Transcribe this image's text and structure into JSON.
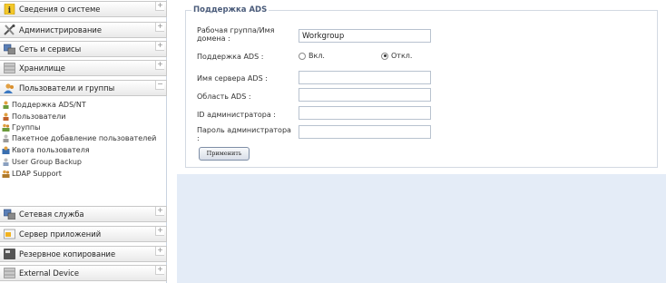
{
  "sidebar": {
    "menus": [
      {
        "label": "Сведения о системе",
        "icon": "info-icon",
        "toggle": "+"
      },
      {
        "label": "Администрирование",
        "icon": "tools-icon",
        "toggle": "+"
      },
      {
        "label": "Сеть и сервисы",
        "icon": "network-icon",
        "toggle": "+"
      },
      {
        "label": "Хранилище",
        "icon": "storage-icon",
        "toggle": "+"
      },
      {
        "label": "Пользователи и группы",
        "icon": "users-icon",
        "toggle": "−"
      },
      {
        "label": "Сетевая служба",
        "icon": "network-service-icon",
        "toggle": "+"
      },
      {
        "label": "Сервер приложений",
        "icon": "app-server-icon",
        "toggle": "+"
      },
      {
        "label": "Резервное копирование",
        "icon": "backup-icon",
        "toggle": "+"
      },
      {
        "label": "External Device",
        "icon": "external-device-icon",
        "toggle": "+"
      }
    ],
    "submenu": [
      {
        "label": "Поддержка ADS/NT",
        "icon": "ads-icon"
      },
      {
        "label": "Пользователи",
        "icon": "user-icon"
      },
      {
        "label": "Группы",
        "icon": "group-icon"
      },
      {
        "label": "Пакетное добавление пользователей",
        "icon": "batch-add-icon"
      },
      {
        "label": "Квота пользователя",
        "icon": "quota-icon"
      },
      {
        "label": "User Group Backup",
        "icon": "user-group-backup-icon"
      },
      {
        "label": "LDAP Support",
        "icon": "ldap-icon"
      }
    ]
  },
  "form": {
    "legend": "Поддержка ADS",
    "workgroup_label": "Рабочая группа/Имя домена :",
    "workgroup_value": "Workgroup",
    "ads_label": "Поддержка ADS :",
    "ads_on": "Вкл.",
    "ads_off": "Откл.",
    "ads_selected": "Откл.",
    "server_label": "Имя сервера ADS :",
    "server_value": "",
    "realm_label": "Область ADS :",
    "realm_value": "",
    "admin_id_label": "ID администратора :",
    "admin_id_value": "",
    "admin_pass_label": "Пароль администратора :",
    "admin_pass_value": "",
    "apply_label": "Применить"
  },
  "colors": {
    "content_bg": "#e4ecf7",
    "legend_text": "#4a5b7a"
  }
}
